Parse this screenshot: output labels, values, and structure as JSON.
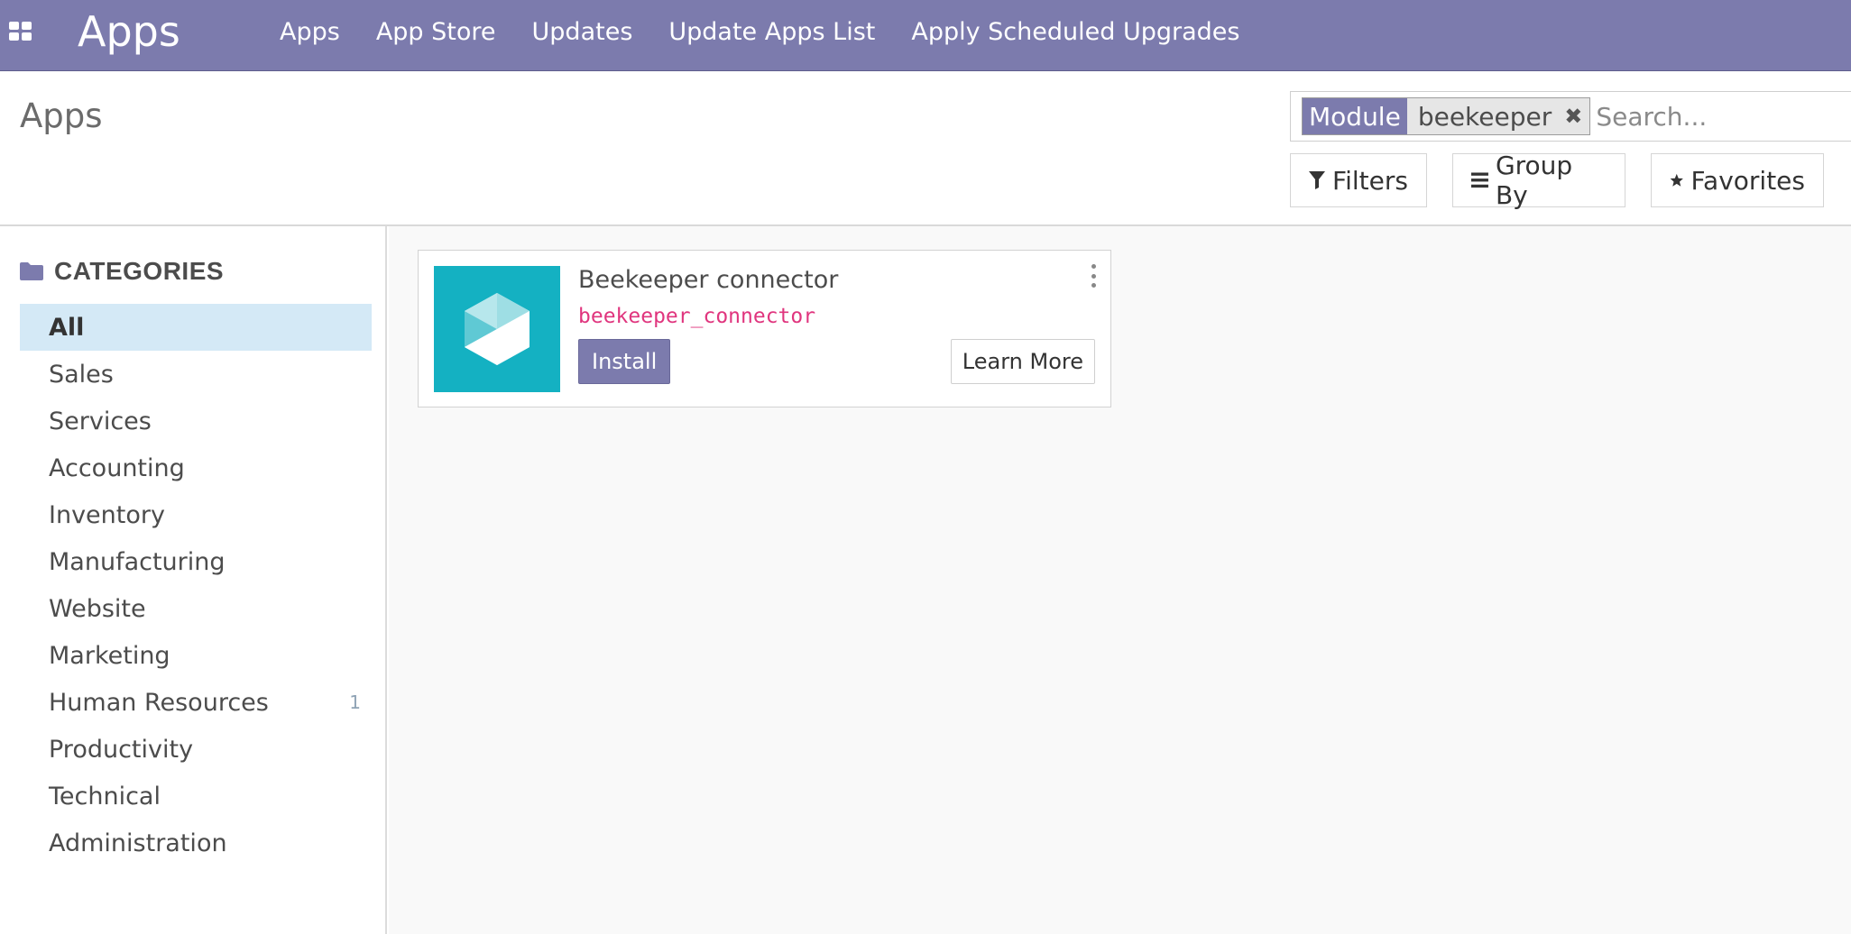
{
  "navbar": {
    "brand": "Apps",
    "menu": [
      "Apps",
      "App Store",
      "Updates",
      "Update Apps List",
      "Apply Scheduled Upgrades"
    ],
    "background_color": "#7c7bad"
  },
  "control_panel": {
    "breadcrumb": "Apps",
    "search": {
      "facet_label": "Module",
      "facet_value": "beekeeper",
      "placeholder": "Search..."
    },
    "buttons": {
      "filters": "Filters",
      "group_by": "Group By",
      "favorites": "Favorites"
    }
  },
  "sidebar": {
    "header": "CATEGORIES",
    "items": [
      {
        "label": "All",
        "active": true,
        "count": ""
      },
      {
        "label": "Sales",
        "count": ""
      },
      {
        "label": "Services",
        "count": ""
      },
      {
        "label": "Accounting",
        "count": ""
      },
      {
        "label": "Inventory",
        "count": ""
      },
      {
        "label": "Manufacturing",
        "count": ""
      },
      {
        "label": "Website",
        "count": ""
      },
      {
        "label": "Marketing",
        "count": ""
      },
      {
        "label": "Human Resources",
        "count": "1"
      },
      {
        "label": "Productivity",
        "count": ""
      },
      {
        "label": "Technical",
        "count": ""
      },
      {
        "label": "Administration",
        "count": ""
      }
    ]
  },
  "apps": [
    {
      "name": "Beekeeper connector",
      "technical_name": "beekeeper_connector",
      "install_label": "Install",
      "learn_more_label": "Learn More",
      "icon": "hexagon-cube-icon",
      "icon_color": "#14b1c2"
    }
  ]
}
